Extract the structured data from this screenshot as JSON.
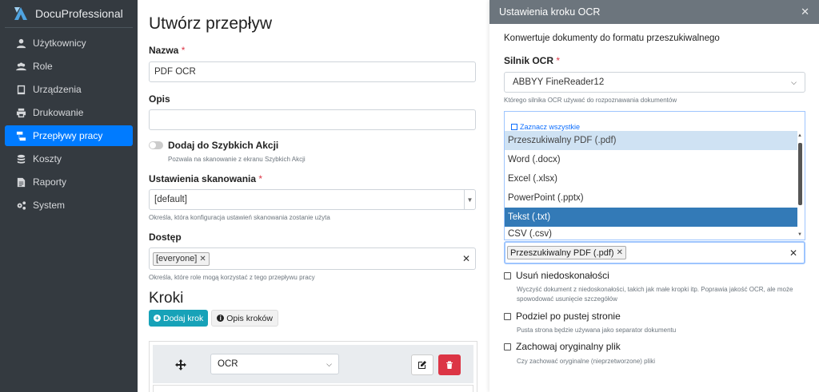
{
  "brand": {
    "name": "DocuProfessional"
  },
  "sidebar": {
    "items": [
      {
        "label": "Użytkownicy",
        "icon": "user-icon",
        "active": false
      },
      {
        "label": "Role",
        "icon": "users-icon",
        "active": false
      },
      {
        "label": "Urządzenia",
        "icon": "tablet-icon",
        "active": false
      },
      {
        "label": "Drukowanie",
        "icon": "printer-icon",
        "active": false
      },
      {
        "label": "Przepływy pracy",
        "icon": "workflow-icon",
        "active": true
      },
      {
        "label": "Koszty",
        "icon": "coins-icon",
        "active": false
      },
      {
        "label": "Raporty",
        "icon": "report-icon",
        "active": false
      },
      {
        "label": "System",
        "icon": "cogs-icon",
        "active": false
      }
    ]
  },
  "form": {
    "title": "Utwórz przepływ",
    "name_label": "Nazwa",
    "required_mark": "*",
    "name_value": "PDF OCR",
    "description_label": "Opis",
    "description_value": "",
    "quick_action_label": "Dodaj do Szybkich Akcji",
    "quick_action_help": "Pozwala na skanowanie z ekranu Szybkich Akcji",
    "scan_settings_label": "Ustawienia skanowania",
    "scan_settings_value": "[default]",
    "scan_settings_help": "Określa, która konfiguracja ustawień skanowania zostanie użyta",
    "access_label": "Dostęp",
    "access_tag": "[everyone]",
    "access_help": "Określa, które role mogą korzystać z tego przepływu pracy",
    "steps_title": "Kroki",
    "add_step_label": "Dodaj krok",
    "steps_info_label": "Opis kroków",
    "step_type_value": "OCR"
  },
  "panel": {
    "title": "Ustawienia kroku OCR",
    "description": "Konwertuje dokumenty do formatu przeszukiwalnego",
    "engine_label": "Silnik OCR",
    "engine_value": "ABBYY FineReader12",
    "engine_help": "Którego silnika OCR używać do rozpoznawania dokumentów",
    "select_all_label": "Zaznacz wszystkie",
    "format_options": [
      "Przeszukiwalny PDF (.pdf)",
      "Word (.docx)",
      "Excel (.xlsx)",
      "PowerPoint (.pptx)",
      "Tekst (.txt)",
      "CSV (.csv)"
    ],
    "selected_format_tag": "Przeszukiwalny PDF (.pdf)",
    "remove_imperfections_label": "Usuń niedoskonałości",
    "remove_imperfections_help": "Wyczyść dokument z niedoskonałości, takich jak małe kropki itp. Poprawia jakość OCR, ale może spowodować usunięcie szczegółów",
    "split_blank_label": "Podziel po pustej stronie",
    "split_blank_help": "Pusta strona będzie używana jako separator dokumentu",
    "keep_original_label": "Zachowaj oryginalny plik",
    "keep_original_help": "Czy zachować oryginalne (nieprzetworzone) pliki"
  },
  "colors": {
    "sidebar_bg": "#343a40",
    "active_nav": "#007bff",
    "add_step_button": "#17a2b8",
    "delete_button": "#dc3545",
    "highlight_option": "#337ab7"
  }
}
